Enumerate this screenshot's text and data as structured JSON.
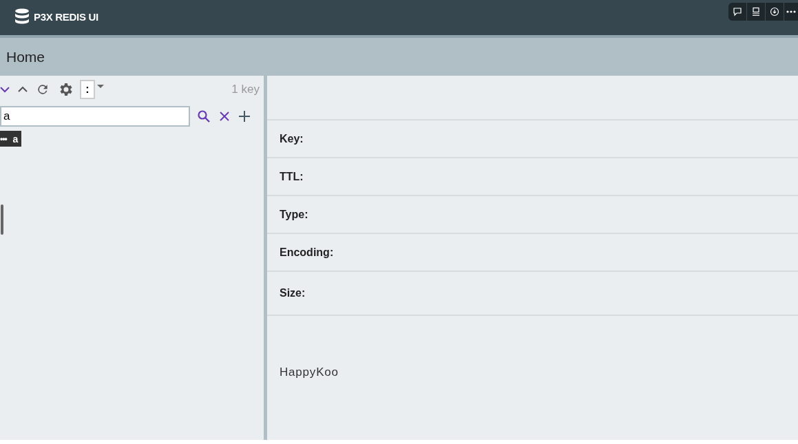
{
  "app": {
    "title": "P3X REDIS UI"
  },
  "breadcrumb": "Home",
  "toolbar": {
    "separator": ":",
    "key_count": "1 key"
  },
  "search": {
    "value": "a"
  },
  "tree": [
    {
      "dots": "•••",
      "label": "a"
    }
  ],
  "details": [
    {
      "label": "Key:"
    },
    {
      "label": "TTL:"
    },
    {
      "label": "Type:"
    },
    {
      "label": "Encoding:"
    },
    {
      "label": "Size:"
    }
  ],
  "footer_text": "HappyKoo"
}
